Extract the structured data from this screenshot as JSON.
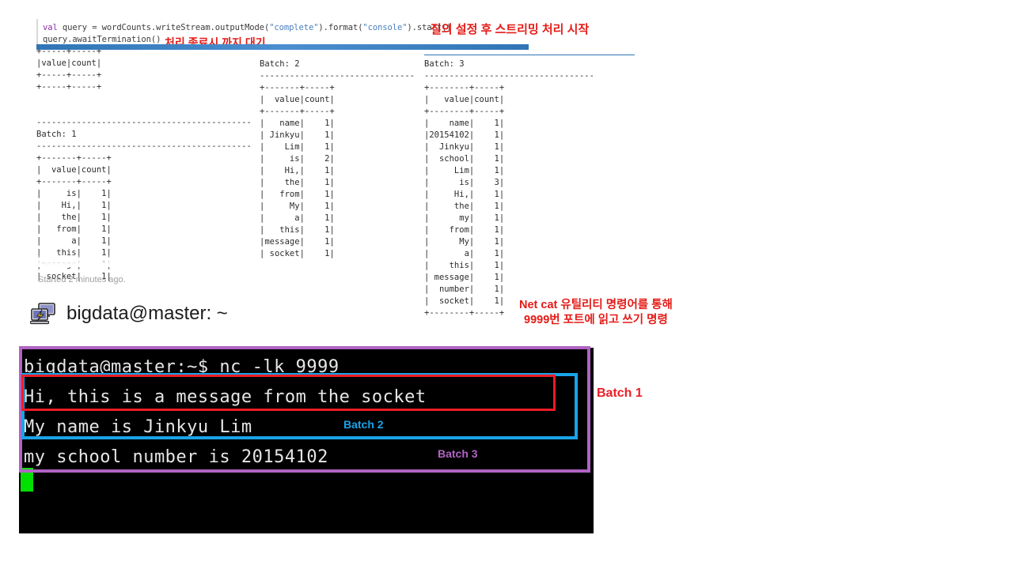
{
  "code": {
    "line1": {
      "kw": "val",
      "p1": " query = wordCounts.writeStream.outputMode(",
      "s1": "\"complete\"",
      "p2": ").format(",
      "s2": "\"console\"",
      "p3": ").start()"
    },
    "line2": "query.awaitTermination()"
  },
  "annotations": {
    "query_start": "질의 설정 후 스트리밍 처리 시작",
    "await_termination": "처리 종료시 까지 대기",
    "netcat_line1": "Net cat 유틸리티 명령어를 통해",
    "netcat_line2": "9999번 포트에 읽고 쓰기 명령"
  },
  "status": {
    "started": "Started 2 minutes ago."
  },
  "console": {
    "column1": "+-----+-----+\n|value|count|\n+-----+-----+\n+-----+-----+\n\n\n-------------------------------------------\nBatch: 1\n-------------------------------------------\n+-------+-----+\n|  value|count|\n+-------+-----+\n|     is|    1|\n|    Hi,|    1|\n|    the|    1|\n|   from|    1|\n|      a|    1|\n|   this|    1|\n|message|    1|\n| socket|    1|",
    "column2": "Batch: 2\n-------------------------------\n+-------+-----+\n|  value|count|\n+-------+-----+\n|   name|    1|\n| Jinkyu|    1|\n|    Lim|    1|\n|     is|    2|\n|    Hi,|    1|\n|    the|    1|\n|   from|    1|\n|     My|    1|\n|      a|    1|\n|   this|    1|\n|message|    1|\n| socket|    1|",
    "column3": "Batch: 3\n----------------------------------\n+--------+-----+\n|   value|count|\n+--------+-----+\n|    name|    1|\n|20154102|    1|\n|  Jinkyu|    1|\n|  school|    1|\n|     Lim|    1|\n|      is|    3|\n|     Hi,|    1|\n|     the|    1|\n|      my|    1|\n|    from|    1|\n|      My|    1|\n|       a|    1|\n|    this|    1|\n| message|    1|\n|  number|    1|\n|  socket|    1|\n+--------+-----+"
  },
  "batch_tables": {
    "headers": [
      "value",
      "count"
    ],
    "empty_batch": {
      "title": "",
      "rows": []
    },
    "batch1": {
      "title": "Batch: 1",
      "rows": [
        [
          "is",
          1
        ],
        [
          "Hi,",
          1
        ],
        [
          "the",
          1
        ],
        [
          "from",
          1
        ],
        [
          "a",
          1
        ],
        [
          "this",
          1
        ],
        [
          "message",
          1
        ],
        [
          "socket",
          1
        ]
      ]
    },
    "batch2": {
      "title": "Batch: 2",
      "rows": [
        [
          "name",
          1
        ],
        [
          "Jinkyu",
          1
        ],
        [
          "Lim",
          1
        ],
        [
          "is",
          2
        ],
        [
          "Hi,",
          1
        ],
        [
          "the",
          1
        ],
        [
          "from",
          1
        ],
        [
          "My",
          1
        ],
        [
          "a",
          1
        ],
        [
          "this",
          1
        ],
        [
          "message",
          1
        ],
        [
          "socket",
          1
        ]
      ]
    },
    "batch3": {
      "title": "Batch: 3",
      "rows": [
        [
          "name",
          1
        ],
        [
          "20154102",
          1
        ],
        [
          "Jinkyu",
          1
        ],
        [
          "school",
          1
        ],
        [
          "Lim",
          1
        ],
        [
          "is",
          3
        ],
        [
          "Hi,",
          1
        ],
        [
          "the",
          1
        ],
        [
          "my",
          1
        ],
        [
          "from",
          1
        ],
        [
          "My",
          1
        ],
        [
          "a",
          1
        ],
        [
          "this",
          1
        ],
        [
          "message",
          1
        ],
        [
          "number",
          1
        ],
        [
          "socket",
          1
        ]
      ]
    }
  },
  "terminal": {
    "window_title": "bigdata@master: ~",
    "icon": "remote-desktop-icon",
    "lines": "bigdata@master:~$ nc -lk 9999\nHi, this is a message from the socket\nMy name is Jinkyu Lim\nmy school number is 20154102",
    "prompt": "bigdata@master:~$",
    "command": "nc -lk 9999",
    "input_line1": "Hi, this is a message from the socket",
    "input_line2": "My name is Jinkyu Lim",
    "input_line3": "my school number is 20154102",
    "cursor": "block"
  },
  "batch_tags": {
    "batch1": "Batch 1",
    "batch2": "Batch 2",
    "batch3": "Batch 3"
  },
  "colors": {
    "batch1_box": "#b163c4",
    "batch2_box": "#19a3e8",
    "batch3_box": "#ee1c25",
    "annotation_red": "#e41b17",
    "divider_blue": "#2f75b5",
    "cursor_green": "#00e000",
    "terminal_bg": "#000000",
    "terminal_fg": "#e6e6e6"
  }
}
